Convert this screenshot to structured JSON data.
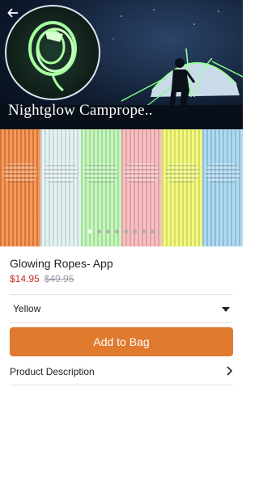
{
  "hero": {
    "banner_text": "Nightglow Camprope..",
    "bundle_colors": [
      "#f2833a",
      "#dfeff0",
      "#b8f5ae",
      "#f6b3b6",
      "#eef76a",
      "#9fd2ef"
    ],
    "dot_count": 8,
    "active_dot": 0
  },
  "product": {
    "name": "Glowing Ropes- App",
    "sale_price": "$14.95",
    "original_price": "$49.95"
  },
  "variant": {
    "selected": "Yellow"
  },
  "actions": {
    "add_to_bag": "Add to Bag",
    "product_description": "Product Description"
  },
  "colors": {
    "accent": "#e07a2f",
    "sale_price": "#c62828",
    "original_price": "#9a9aa8"
  }
}
